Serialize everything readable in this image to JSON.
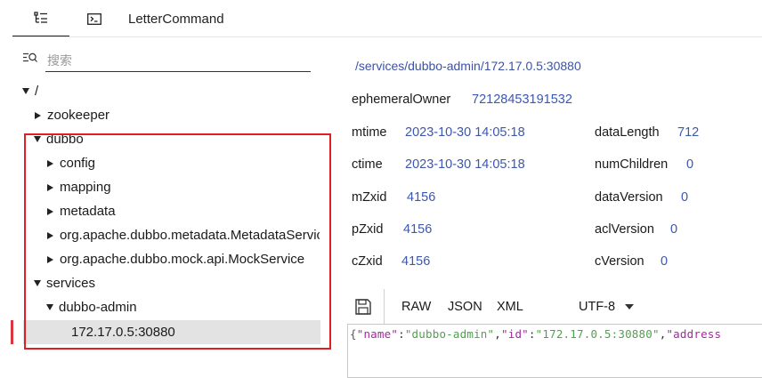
{
  "tabs": {
    "tree_icon": "tree-list-icon",
    "terminal_icon": "terminal-icon",
    "letter_command": "LetterCommand"
  },
  "search": {
    "placeholder": "搜索",
    "icon": "search-filter-icon"
  },
  "tree": {
    "root": "/",
    "zookeeper": "zookeeper",
    "dubbo": "dubbo",
    "config": "config",
    "mapping": "mapping",
    "metadata": "metadata",
    "metadata_service": "org.apache.dubbo.metadata.MetadataService",
    "mock_service": "org.apache.dubbo.mock.api.MockService",
    "services": "services",
    "dubbo_admin": "dubbo-admin",
    "selected_node": "172.17.0.5:30880"
  },
  "details": {
    "path": "/services/dubbo-admin/172.17.0.5:30880",
    "ephemeralOwner_label": "ephemeralOwner",
    "ephemeralOwner_value": "72128453191532",
    "mtime_label": "mtime",
    "mtime_value": "2023-10-30 14:05:18",
    "ctime_label": "ctime",
    "ctime_value": "2023-10-30 14:05:18",
    "mZxid_label": "mZxid",
    "mZxid_value": "4156",
    "pZxid_label": "pZxid",
    "pZxid_value": "4156",
    "cZxid_label": "cZxid",
    "cZxid_value": "4156",
    "dataLength_label": "dataLength",
    "dataLength_value": "712",
    "numChildren_label": "numChildren",
    "numChildren_value": "0",
    "dataVersion_label": "dataVersion",
    "dataVersion_value": "0",
    "aclVersion_label": "aclVersion",
    "aclVersion_value": "0",
    "cVersion_label": "cVersion",
    "cVersion_value": "0"
  },
  "editor": {
    "save_icon": "save-icon",
    "raw": "RAW",
    "json": "JSON",
    "xml": "XML",
    "encoding": "UTF-8",
    "code": {
      "open": "{",
      "k1": "\"name\"",
      "colon1": ":",
      "v1": "\"dubbo-admin\"",
      "comma1": ",",
      "k2": "\"id\"",
      "colon2": ":",
      "v2": "\"172.17.0.5:30880\"",
      "comma2": ",",
      "k3": "\"address"
    }
  },
  "colors": {
    "highlight_box": "#e02020",
    "value_blue": "#3b57b0",
    "json_key": "#a626a4",
    "json_string": "#50a14f"
  }
}
